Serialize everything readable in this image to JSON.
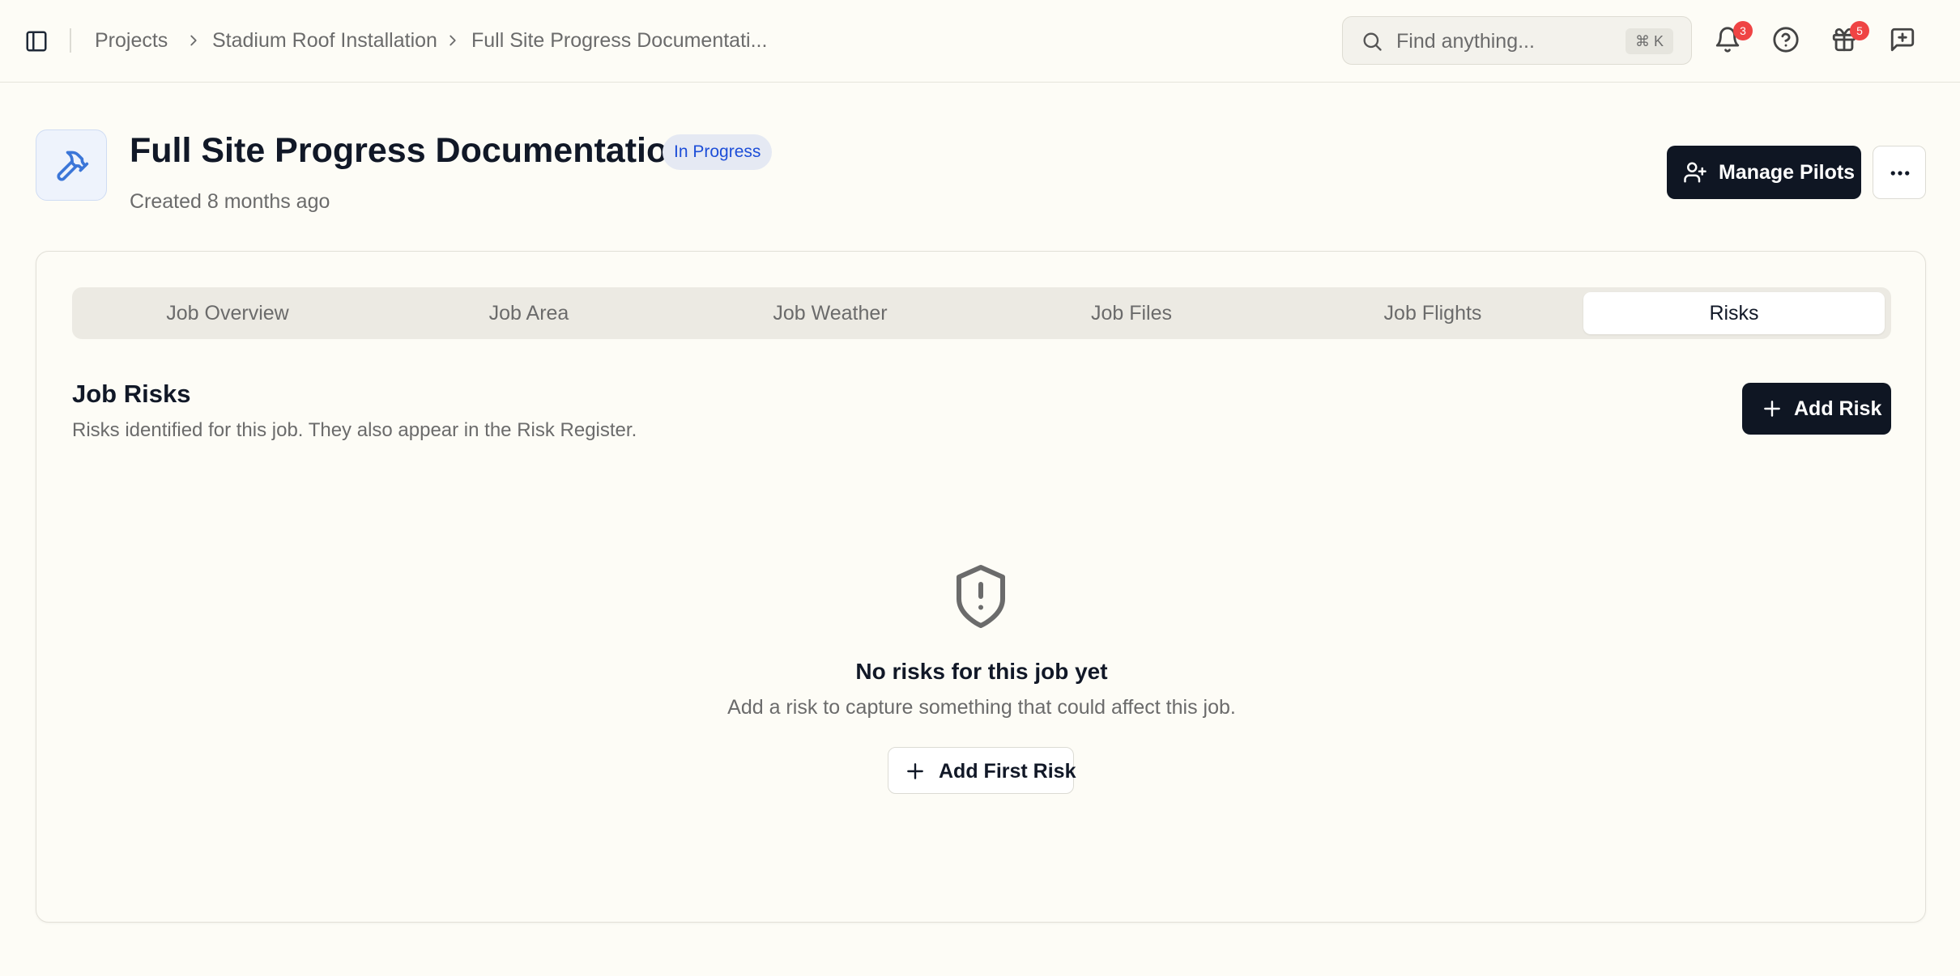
{
  "breadcrumb": {
    "items": [
      "Projects",
      "Stadium Roof Installation",
      "Full Site Progress Documentati..."
    ]
  },
  "search": {
    "placeholder": "Find anything...",
    "shortcut": "⌘ K"
  },
  "header": {
    "notifications_count": "3",
    "gifts_count": "5",
    "icons": [
      "sidebar-toggle-icon",
      "search-icon",
      "bell-icon",
      "help-circle-icon",
      "gift-icon",
      "message-plus-icon"
    ]
  },
  "job": {
    "title": "Full Site Progress Documentation",
    "status": "In Progress",
    "created": "Created 8 months ago",
    "icon": "hammer-icon",
    "manage_pilots_label": "Manage Pilots"
  },
  "tabs": [
    {
      "label": "Job Overview"
    },
    {
      "label": "Job Area"
    },
    {
      "label": "Job Weather"
    },
    {
      "label": "Job Files"
    },
    {
      "label": "Job Flights"
    },
    {
      "label": "Risks",
      "active": true
    }
  ],
  "risks": {
    "title": "Job Risks",
    "subtitle": "Risks identified for this job. They also appear in the Risk Register.",
    "add_label": "Add Risk",
    "empty_title": "No risks for this job yet",
    "empty_subtitle": "Add a risk to capture something that could affect this job.",
    "add_first_label": "Add First Risk"
  },
  "colors": {
    "accent_dark": "#0f1623",
    "status_blue": "#1d4ed8",
    "badge_red": "#ef4444",
    "background": "#fdfcf6"
  }
}
